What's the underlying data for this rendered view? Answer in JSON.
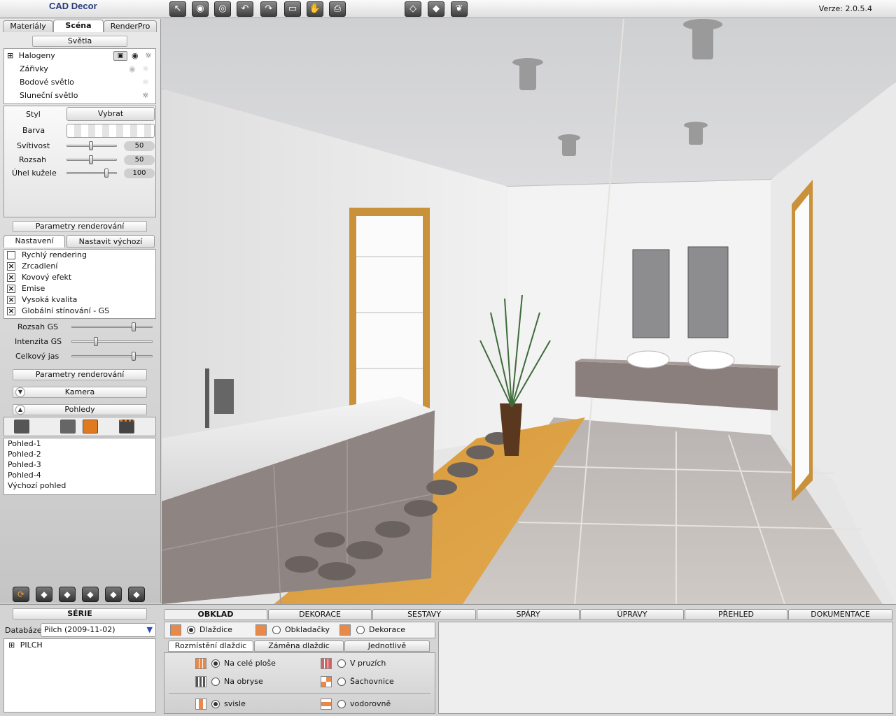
{
  "app": {
    "title": "CAD Decor",
    "version": "Verze: 2.0.5.4"
  },
  "toolbar": {
    "tools": [
      "select-icon",
      "eye-icon",
      "eye-closed-icon",
      "undo-icon",
      "redo-icon",
      "screen-icon",
      "hand-icon",
      "print-icon",
      "cube-outline-icon",
      "cube-solid-icon",
      "butterfly-icon"
    ]
  },
  "left": {
    "tabs": [
      "Materiály",
      "Scéna",
      "RenderPro"
    ],
    "active_tab": "Scéna",
    "lights_header": "Světla",
    "lights": [
      {
        "label": "Halogeny",
        "expand": "⊞"
      },
      {
        "label": "Zářivky"
      },
      {
        "label": "Bodové světlo"
      },
      {
        "label": "Sluneční světlo"
      }
    ],
    "style_label": "Styl",
    "style_button": "Vybrat",
    "color_label": "Barva",
    "sliders": [
      {
        "label": "Svítivost",
        "value": "50",
        "level": 0.5
      },
      {
        "label": "Rozsah",
        "value": "50",
        "level": 0.5
      },
      {
        "label": "Úhel kužele",
        "value": "100",
        "level": 0.8
      }
    ],
    "render_params_header": "Parametry renderování",
    "render_tabs": [
      "Nastavení",
      "Nastavit výchozí"
    ],
    "render_options": [
      {
        "label": "Rychlý rendering",
        "checked": false
      },
      {
        "label": "Zrcadlení",
        "checked": true
      },
      {
        "label": "Kovový efekt",
        "checked": true
      },
      {
        "label": "Emise",
        "checked": true
      },
      {
        "label": "Vysoká kvalita",
        "checked": true
      },
      {
        "label": "Globální stínování - GS",
        "checked": true
      }
    ],
    "gs_sliders": [
      {
        "label": "Rozsah GS",
        "level": 0.78
      },
      {
        "label": "Intenzita GS",
        "level": 0.3
      },
      {
        "label": "Celkový jas",
        "level": 0.78
      }
    ],
    "render_params_header2": "Parametry renderování",
    "camera_header": "Kamera",
    "views_header": "Pohledy",
    "views": [
      "Pohled-1",
      "Pohled-2",
      "Pohled-3",
      "Pohled-4",
      "Výchozí pohled"
    ],
    "bottom_icons": [
      "refresh-icon",
      "cube-front-icon",
      "cube-left-icon",
      "cube-right-icon",
      "cube-back-icon",
      "cube-top-icon"
    ]
  },
  "series": {
    "header": "SÉRIE",
    "db_label": "Databáze",
    "db_value": "Pilch (2009-11-02)",
    "tree_item": "PILCH",
    "tree_expand": "⊞"
  },
  "bottom_tabs": [
    "OBKLAD",
    "DEKORACE",
    "SESTAVY",
    "SPÁRY",
    "ÚPRAVY",
    "PŘEHLED",
    "DOKUMENTACE"
  ],
  "obklad": {
    "types": [
      "Dlaždice",
      "Obkladačky",
      "Dekorace"
    ],
    "subtabs": [
      "Rozmístění dlaždic",
      "Záměna dlaždic",
      "Jednotlivě"
    ],
    "layout_options": [
      "Na celé ploše",
      "V pruzích",
      "Na obryse",
      "Šachovnice"
    ],
    "orientation_options": [
      "svisle",
      "vodorovně"
    ]
  }
}
